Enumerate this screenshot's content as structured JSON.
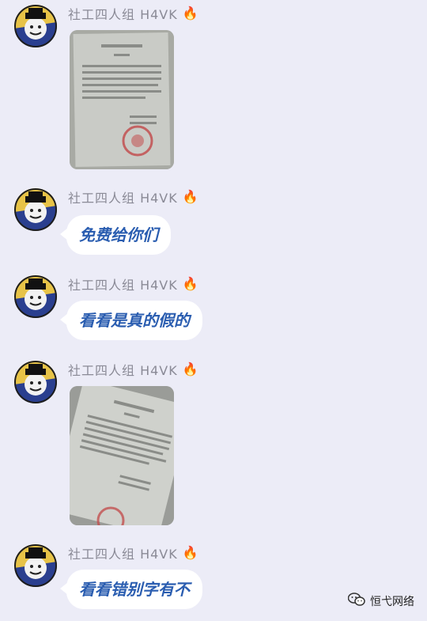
{
  "messages": [
    {
      "sender": "社工四人组 H4VK",
      "badge_icon": "fire-icon",
      "type": "image",
      "image_desc": "document-photo"
    },
    {
      "sender": "社工四人组 H4VK",
      "badge_icon": "fire-icon",
      "type": "text",
      "text": "免费给你们"
    },
    {
      "sender": "社工四人组 H4VK",
      "badge_icon": "fire-icon",
      "type": "text",
      "text": "看看是真的假的"
    },
    {
      "sender": "社工四人组 H4VK",
      "badge_icon": "fire-icon",
      "type": "image",
      "image_desc": "document-photo"
    },
    {
      "sender": "社工四人组 H4VK",
      "badge_icon": "fire-icon",
      "type": "text",
      "text": "看看错别字有不"
    }
  ],
  "watermark": {
    "icon": "wechat-icon",
    "text": "恒弋网络"
  },
  "colors": {
    "background": "#ececf7",
    "bubble": "#ffffff",
    "bubble_text": "#2a5db0",
    "sender_name": "#8a8a96",
    "fire": "#ff6a2b"
  }
}
